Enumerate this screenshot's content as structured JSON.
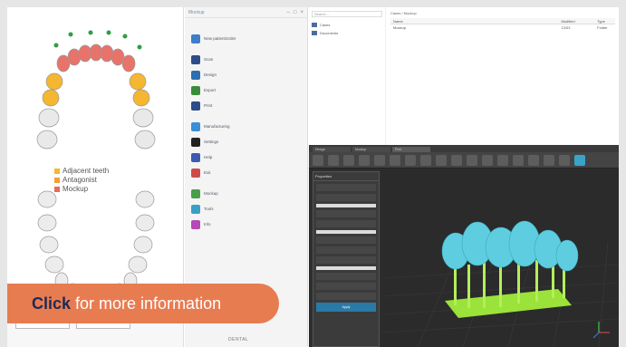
{
  "legend": {
    "items": [
      {
        "label": "Adjacent teeth",
        "color": "#f5b731"
      },
      {
        "label": "Antagonist",
        "color": "#f2a036"
      },
      {
        "label": "Mockup",
        "color": "#e86a5a"
      }
    ]
  },
  "menu": {
    "title": "Mockup",
    "items": [
      {
        "label": "New patient/order",
        "color": "#3d7ec9"
      },
      {
        "label": "Scan",
        "color": "#2d4d88"
      },
      {
        "label": "Design",
        "color": "#2d6fae"
      },
      {
        "label": "Export",
        "color": "#3a8c3a"
      },
      {
        "label": "Print",
        "color": "#2d4d88"
      },
      {
        "label": "Manufacturing",
        "color": "#3a8fd6"
      },
      {
        "label": "Settings",
        "color": "#222222"
      },
      {
        "label": "Help",
        "color": "#3c5bb0"
      },
      {
        "label": "Exit",
        "color": "#d04a4a"
      },
      {
        "label": "Mockup",
        "color": "#4a9e4a"
      },
      {
        "label": "Tools",
        "color": "#3aa0c8"
      },
      {
        "label": "Info",
        "color": "#b64ab6"
      }
    ],
    "footer": "DENTAL"
  },
  "files": {
    "search_placeholder": "Search...",
    "nav": [
      "Cases",
      "Documents"
    ],
    "path": "Cases / Mockup",
    "headers": [
      "Name",
      "Modified",
      "Type"
    ],
    "rows": [
      [
        "Mockup",
        "12/03",
        "Folder"
      ]
    ]
  },
  "app": {
    "tabs": [
      "Design",
      "Mockup",
      "Print"
    ],
    "panel_title": "Properties",
    "panel_button": "Apply"
  },
  "cta": {
    "strong": "Click",
    "rest": "for more information"
  },
  "colors": {
    "accent": "#e87c51",
    "tooth_teal": "#5fcde0",
    "support_green": "#9be23a"
  }
}
